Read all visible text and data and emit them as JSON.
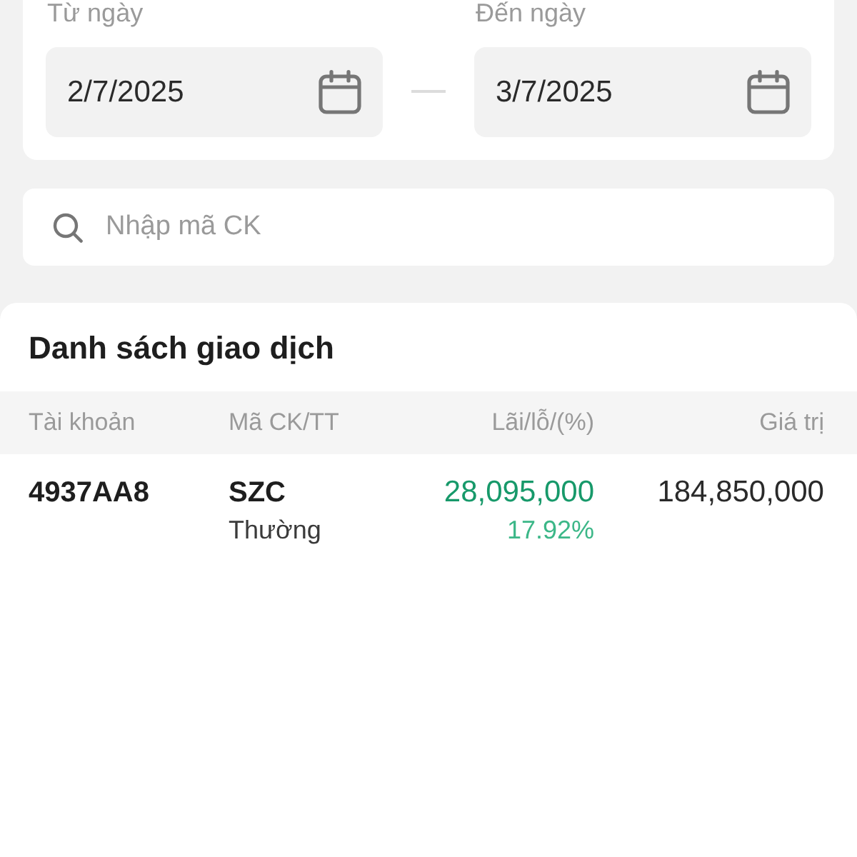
{
  "date_range": [
    {
      "label": "Từ ngày",
      "value": "2/7/2025"
    },
    {
      "label": "Đến ngày",
      "value": "3/7/2025"
    }
  ],
  "search": {
    "placeholder": "Nhập mã CK"
  },
  "transactions": {
    "title": "Danh sách giao dịch",
    "columns": [
      "Tài khoản",
      "Mã CK/TT",
      "Lãi/lỗ/(%)",
      "Giá trị"
    ],
    "rows": [
      {
        "account": "4937AA8",
        "symbol": "SZC",
        "order_type": "Thường",
        "profit_loss": "28,095,000",
        "profit_loss_pct": "17.92%",
        "value": "184,850,000",
        "gain": true
      }
    ]
  }
}
